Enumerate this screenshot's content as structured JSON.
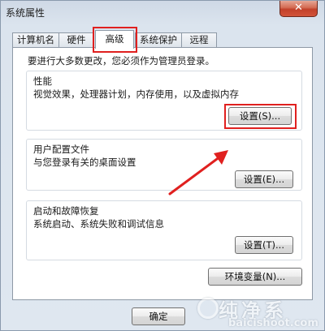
{
  "window": {
    "title": "系统属性",
    "close_glyph": "✕"
  },
  "tabs": [
    {
      "label": "计算机名"
    },
    {
      "label": "硬件"
    },
    {
      "label": "高级"
    },
    {
      "label": "系统保护"
    },
    {
      "label": "远程"
    }
  ],
  "active_tab": "高级",
  "panel": {
    "note": "要进行大多数更改，您必须作为管理员登录。",
    "performance": {
      "title": "性能",
      "desc": "视觉效果，处理器计划，内存使用，以及虚拟内存",
      "button": "设置(S)..."
    },
    "user_profiles": {
      "title": "用户配置文件",
      "desc": "与您登录有关的桌面设置",
      "button": "设置(E)..."
    },
    "startup_recovery": {
      "title": "启动和故障恢复",
      "desc": "系统启动、系统失败和调试信息",
      "button": "设置(T)..."
    },
    "env_button": "环境变量(N)..."
  },
  "footer": {
    "ok_button": "确定"
  },
  "colors": {
    "highlight": "#e0201f",
    "window_bg": "#dfe7f0"
  },
  "watermark": {
    "big": "纯净系",
    "small": "baicishoot.com"
  }
}
